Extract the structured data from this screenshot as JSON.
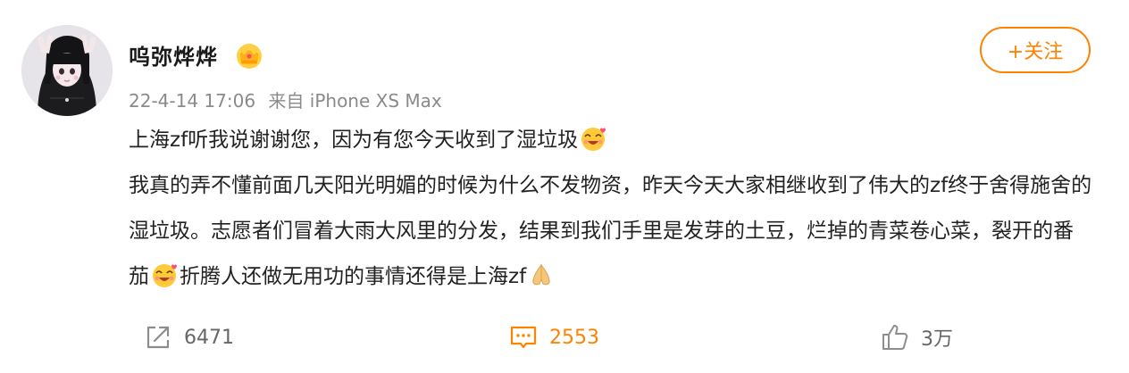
{
  "post": {
    "username": "呜弥烨烨",
    "timestamp": "22-4-14 17:06",
    "source": "来自 iPhone XS Max",
    "follow_label": "+关注",
    "paragraphs": {
      "p1": "上海zf听我说谢谢您，因为有您今天收到了湿垃圾",
      "p2a": "我真的弄不懂前面几天阳光明媚的时候为什么不发物资，昨天今天大家相继收到了伟大的zf终于舍得施舍的湿垃圾。志愿者们冒着大雨大风里的分发，结果到我们手里是发芽的土豆，烂掉的青菜卷心菜，裂开的番茄",
      "p2b": "折腾人还做无用功的事情还得是上海zf"
    }
  },
  "actions": {
    "forward_count": "6471",
    "comment_count": "2553",
    "like_count": "3万"
  },
  "icons": {
    "avatar": "avatar-image",
    "crown": "crown-badge-icon",
    "emoji_love": "love-emoji-icon",
    "emoji_pray": "pray-emoji-icon",
    "forward": "share-forward-icon",
    "comment": "comment-icon",
    "like": "thumbs-up-icon"
  },
  "colors": {
    "accent": "#ff8200",
    "meta": "#8a8a8a",
    "text": "#222222"
  }
}
